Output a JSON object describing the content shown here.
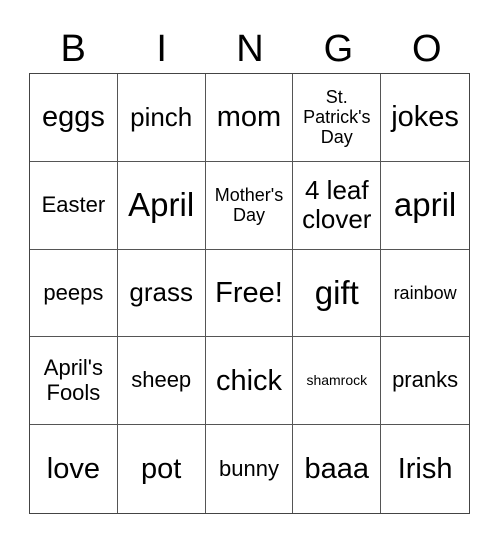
{
  "header": [
    "B",
    "I",
    "N",
    "G",
    "O"
  ],
  "cells": [
    [
      "eggs",
      "pinch",
      "mom",
      "St. Patrick's Day",
      "jokes"
    ],
    [
      "Easter",
      "April",
      "Mother's Day",
      "4 leaf clover",
      "april"
    ],
    [
      "peeps",
      "grass",
      "Free!",
      "gift",
      "rainbow"
    ],
    [
      "April's Fools",
      "sheep",
      "chick",
      "shamrock",
      "pranks"
    ],
    [
      "love",
      "pot",
      "bunny",
      "baaa",
      "Irish"
    ]
  ]
}
